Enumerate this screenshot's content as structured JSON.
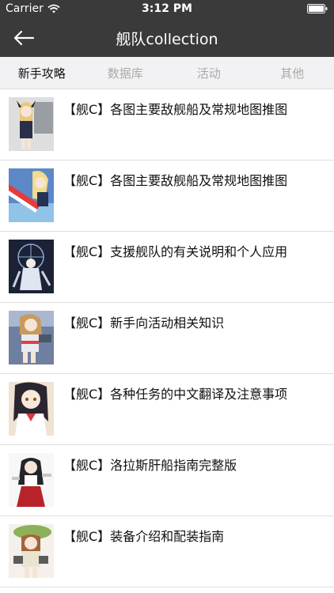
{
  "status_bar": {
    "carrier": "Carrier",
    "time": "3:12 PM",
    "wifi_icon": "wifi-icon",
    "battery_icon": "battery-icon"
  },
  "nav": {
    "title": "舰队collection",
    "back_icon": "arrow-left-icon"
  },
  "tabs": [
    {
      "label": "新手攻略",
      "active": true
    },
    {
      "label": "数据库",
      "active": false
    },
    {
      "label": "活动",
      "active": false
    },
    {
      "label": "其他",
      "active": false
    }
  ],
  "articles": [
    {
      "title": "【舰C】各图主要敌舰船及常规地图推图"
    },
    {
      "title": "【舰C】各图主要敌舰船及常规地图推图"
    },
    {
      "title": "【舰C】支援舰队的有关说明和个人应用"
    },
    {
      "title": "【舰C】新手向活动相关知识"
    },
    {
      "title": "【舰C】各种任务的中文翻译及注意事项"
    },
    {
      "title": "【舰C】洛拉斯肝船指南完整版"
    },
    {
      "title": "【舰C】装备介绍和配装指南"
    }
  ],
  "colors": {
    "bar_background": "#3a3a3a",
    "tab_background": "#f2f2f4",
    "tab_active": "#111111",
    "tab_inactive": "#a9a9a9"
  }
}
